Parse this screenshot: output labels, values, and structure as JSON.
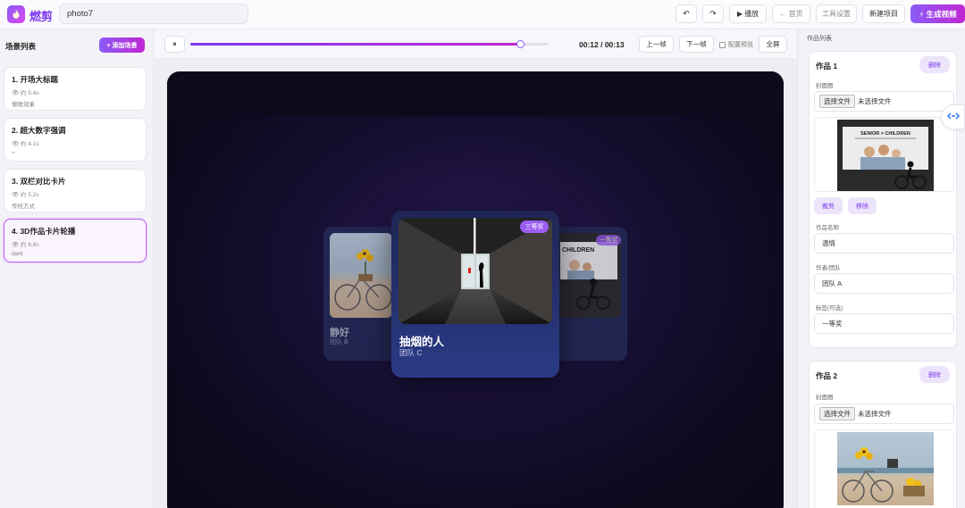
{
  "app": {
    "brand": "燃剪",
    "logo_icon": "flame-icon"
  },
  "header": {
    "project_name": "photo7",
    "undo_icon": "undo-icon",
    "redo_icon": "redo-icon",
    "play_label": "▶ 播放",
    "home_label": "← 首页",
    "settings_label": "工具设置",
    "new_project_label": "新建项目",
    "generate_label": "⚡ 生成视频"
  },
  "scenes": {
    "title": "场景列表",
    "add_label": "+ 添加场景",
    "items": [
      {
        "title": "1. 开场大标题",
        "duration": "👁 约 5.4s",
        "desc": "懒散效果"
      },
      {
        "title": "2. 超大数字强调",
        "duration": "👁 约 4.1s",
        "desc": "+"
      },
      {
        "title": "3. 双栏对比卡片",
        "duration": "👁 约 5.2s",
        "desc": "传统方式"
      },
      {
        "title": "4. 3D作品卡片轮播",
        "duration": "👁 约 6.8s",
        "desc": "dark"
      }
    ]
  },
  "player": {
    "pause_label": "⏸",
    "progress": 0.923,
    "time": "00:12 / 00:13",
    "prev_label": "上一帧",
    "next_label": "下一帧",
    "preview_check_label": "配置预览",
    "fullscreen_label": "全屏"
  },
  "stage": {
    "left_card": {
      "name": "静好",
      "team": "团队 B"
    },
    "main_card": {
      "name": "抽烟的人",
      "team": "团队 C",
      "badge": "三等奖"
    },
    "right_card": {
      "badge": "一等奖",
      "poster_text": "CHILDREN"
    }
  },
  "works": {
    "title": "作品列表",
    "items": [
      {
        "title": "作品 1",
        "delete_label": "删除",
        "cover_label": "封面图",
        "file_btn": "选择文件",
        "file_status": "未选择文件",
        "poster_title": "SENIOR > CHILDREN",
        "crop_label": "裁剪",
        "remove_label": "移除",
        "name_label": "作品名称",
        "name_value": "温情",
        "author_label": "作者/团队",
        "author_value": "团队 A",
        "tag_label": "标签(可选)",
        "tag_value": "一等奖"
      },
      {
        "title": "作品 2",
        "delete_label": "删除",
        "cover_label": "封面图",
        "file_btn": "选择文件",
        "file_status": "未选择文件"
      }
    ]
  }
}
